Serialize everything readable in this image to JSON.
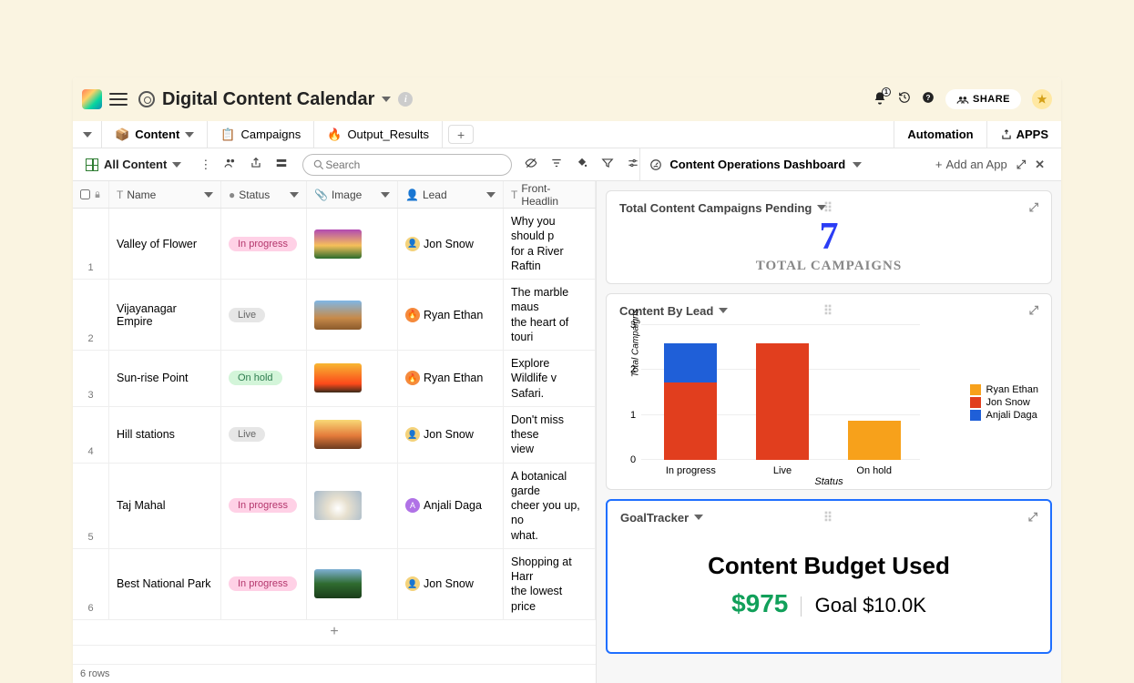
{
  "header": {
    "title": "Digital Content Calendar",
    "bell_count": "1",
    "share_label": "SHARE"
  },
  "tabs": [
    {
      "icon": "📦",
      "label": "Content",
      "active": true,
      "has_chev": true
    },
    {
      "icon": "📋",
      "label": "Campaigns",
      "active": false,
      "has_chev": false
    },
    {
      "icon": "🔥",
      "label": "Output_Results",
      "active": false,
      "has_chev": false
    }
  ],
  "tab_right": {
    "automation": "Automation",
    "apps": "APPS"
  },
  "view": {
    "name": "All Content",
    "search_placeholder": "Search"
  },
  "dashboard": {
    "title": "Content Operations Dashboard",
    "add_app": "Add an App"
  },
  "columns": {
    "name": "Name",
    "status": "Status",
    "image": "Image",
    "lead": "Lead",
    "headline": "Front-Headlin"
  },
  "rows": [
    {
      "n": "1",
      "name": "Valley of Flower",
      "status": "In progress",
      "status_cls": "b-prog",
      "thumb": "linear-gradient(180deg,#b14ab3 0%,#f6c05a 55%,#2a6b2d 100%)",
      "lead": "Jon Snow",
      "av_bg": "#f4d27a",
      "av_txt": "👤",
      "headline": "Why you should p\nfor a River Raftin"
    },
    {
      "n": "2",
      "name": "Vijayanagar Empire",
      "status": "Live",
      "status_cls": "b-live",
      "thumb": "linear-gradient(180deg,#7fb7e6 0%,#c78a4a 60%,#8b5a2b 100%)",
      "lead": "Ryan Ethan",
      "av_bg": "#f58a3c",
      "av_txt": "🔥",
      "headline": "The marble maus\nthe heart of touri"
    },
    {
      "n": "3",
      "name": "Sun-rise Point",
      "status": "On hold",
      "status_cls": "b-hold",
      "thumb": "linear-gradient(180deg,#f7b733 0%,#fc4a1a 70%,#3a2a1a 100%)",
      "lead": "Ryan Ethan",
      "av_bg": "#f58a3c",
      "av_txt": "🔥",
      "headline": "Explore Wildlife v\nSafari."
    },
    {
      "n": "4",
      "name": "Hill stations",
      "status": "Live",
      "status_cls": "b-live",
      "thumb": "linear-gradient(180deg,#f9d976 0%,#e37a3a 55%,#6c3b1f 100%)",
      "lead": "Jon Snow",
      "av_bg": "#f4d27a",
      "av_txt": "👤",
      "headline": "Don't miss these\nview"
    },
    {
      "n": "5",
      "name": "Taj Mahal",
      "status": "In progress",
      "status_cls": "b-prog",
      "thumb": "radial-gradient(circle at 50% 60%, #fff 0%, #e7e0cf 35%, #a7bacb 100%)",
      "lead": "Anjali Daga",
      "av_bg": "#b072e6",
      "av_txt": "A",
      "headline": "A botanical garde\ncheer you up, no\nwhat."
    },
    {
      "n": "6",
      "name": "Best National Park",
      "status": "In progress",
      "status_cls": "b-prog",
      "thumb": "linear-gradient(180deg,#7fb0d4 0%,#2f6b2f 50%,#1b3d1b 100%)",
      "lead": "Jon Snow",
      "av_bg": "#f4d27a",
      "av_txt": "👤",
      "headline": "Shopping at Harr\nthe lowest price"
    }
  ],
  "table_footer": "6 rows",
  "card1": {
    "title": "Total Content Campaigns Pending",
    "value": "7",
    "label": "TOTAL CAMPAIGNS"
  },
  "card2": {
    "title": "Content By Lead"
  },
  "card3": {
    "title": "GoalTracker",
    "heading": "Content Budget Used",
    "amount": "$975",
    "goal": "Goal $10.0K"
  },
  "chart_data": {
    "type": "bar",
    "title": "Content By Lead",
    "xlabel": "Status",
    "ylabel": "Total Campaigns",
    "ylim": [
      0,
      3
    ],
    "yticks": [
      0,
      1,
      2,
      3
    ],
    "categories": [
      "In progress",
      "Live",
      "On hold"
    ],
    "series": [
      {
        "name": "Ryan Ethan",
        "color": "#f7a11b",
        "values": [
          0,
          0,
          1
        ]
      },
      {
        "name": "Jon Snow",
        "color": "#e13e1e",
        "values": [
          2,
          3,
          0
        ]
      },
      {
        "name": "Anjali Daga",
        "color": "#1f5fd8",
        "values": [
          1,
          0,
          0
        ]
      }
    ]
  }
}
